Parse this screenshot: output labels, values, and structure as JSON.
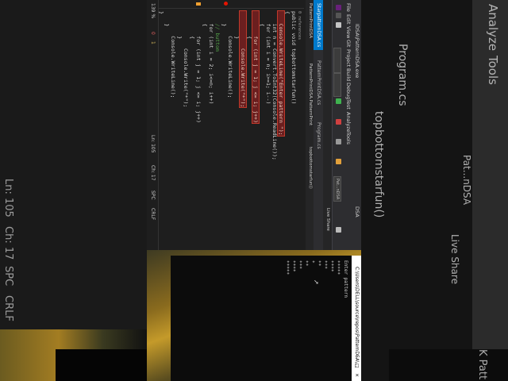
{
  "bg_left": {
    "status_items": [
      "Ln: 105",
      "Ch: 17",
      "SPC",
      "CRLF"
    ]
  },
  "bg_right": {
    "menu": [
      "Analyze",
      "Tools"
    ],
    "file_tab": "Program.cs",
    "member": "topbottomstarfun()",
    "solution_hint": "Pat...nDSA",
    "live_share": "Live Share",
    "console_text": "K Patt"
  },
  "vs": {
    "title": "DSA",
    "exe": "IDSA\\PatternDSA.exe",
    "menu": [
      "File",
      "Edit",
      "View",
      "Git",
      "Project",
      "Build",
      "Debug",
      "Test",
      "Analyze",
      "Tools"
    ],
    "solution_label": "Pat...nDSA",
    "tabs": [
      {
        "label": "StarpatternDSA.cs",
        "active": true
      },
      {
        "label": "PatternPrintDSA.cs",
        "active": false
      },
      {
        "label": "Program.cs",
        "active": false
      }
    ],
    "nav": {
      "project": "PatternPrintDSA",
      "class": "PatternPrintDSA.PatternPrint",
      "member": "topbottomstarfun()"
    },
    "code": [
      "0 references",
      "public void topbottomstarfun()",
      "{",
      "    Console.WriteLine(\"Enter pattern \");",
      "    int n = Convert.ToInt32(Console.ReadLine());",
      "    for (int i = n; i>=1; i--)",
      "    {",
      "        for (int j = 1; j <= i; j++)",
      "        {",
      "            Console.Write(\"*\");",
      "        }",
      "        Console.WriteLine();",
      "    }",
      "    // buttom",
      "    for (int i = 2; i<=n; i++)",
      "    {",
      "        for (int j = 1; j <= i; j++)",
      "        {",
      "            Console.Write(\"*\");",
      "        }",
      "        Console.WriteLine();",
      "    }",
      "}"
    ],
    "status": {
      "zoom": "139 %",
      "errors": "0",
      "warnings": "1",
      "ln": "Ln: 105",
      "ch": "Ch: 17",
      "spc": "SPC",
      "crlf": "CRLF"
    },
    "live_share": "Live Share"
  },
  "console": {
    "title": "C:\\Users\\DELL\\source\\repos\\PatternDSA\\...",
    "prompt": "Enter pattern",
    "output_lines": [
      "*****",
      "****",
      "***",
      "**",
      "*",
      "**",
      "***",
      "****",
      "*****"
    ]
  },
  "colors": {
    "accent": "#007acc",
    "editor_bg": "#1e1e1e",
    "keyword": "#569cd6",
    "type": "#4ec9b0",
    "string": "#d69d85",
    "breakpoint": "#e51400"
  }
}
